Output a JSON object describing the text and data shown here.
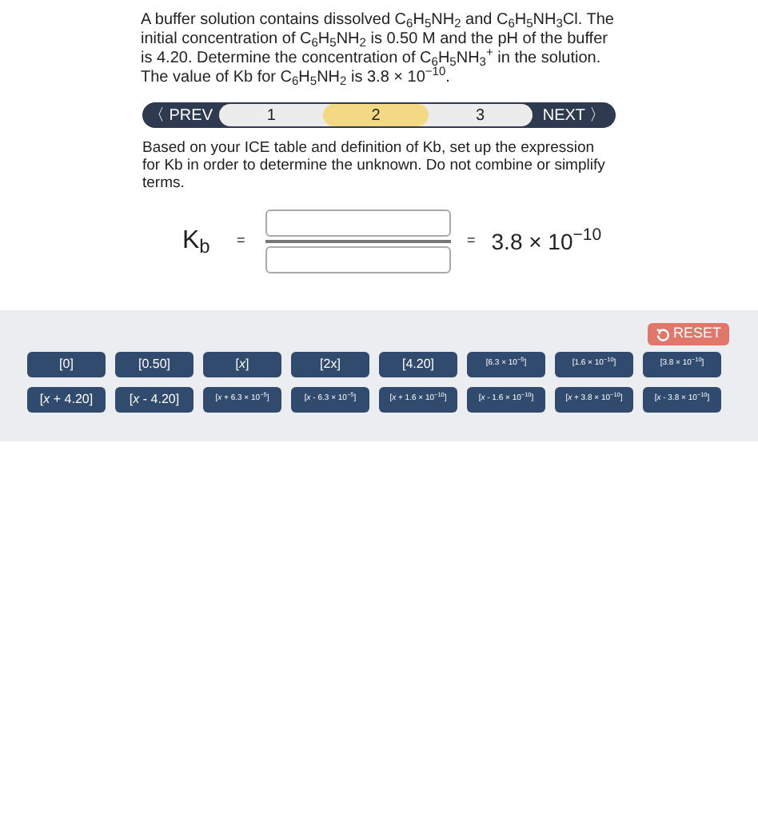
{
  "question": "A buffer solution contains dissolved C$_{6}$H$_{5}$NH$_{2}$ and C$_{6}$H$_{5}$NH$_{3}$Cl. The initial concentration of C$_{6}$H$_{5}$NH$_{2}$ is 0.50 M and the pH of the buffer is 4.20. Determine the concentration of C$_{6}$H$_{5}$NH$_{3}$$^{+}$ in the solution. The value of Kb for C$_{6}$H$_{5}$NH$_{2}$ is 3.8 × 10$^{−10}$.",
  "nav": {
    "prev": "〈 PREV",
    "next": "NEXT 〉",
    "steps": [
      {
        "label": "1",
        "selected": false
      },
      {
        "label": "2",
        "selected": true
      },
      {
        "label": "3",
        "selected": false
      }
    ]
  },
  "instruction": "Based on your ICE table and definition of Kb, set up the expression for Kb in order to determine the unknown. Do not combine or simplify terms.",
  "equation": {
    "lhs": "K$_{b}$",
    "equals": "=",
    "rhs_equals": "=",
    "rhs": "3.8 × 10$^{−10}$"
  },
  "reset": "RESET",
  "tiles": [
    [
      "[0]",
      "[0.50]",
      "[*x*]",
      "[2x]",
      "[4.20]",
      "[6.3 × 10$^{−5}$]",
      "[1.6 × 10$^{−10}$]",
      "[3.8 × 10$^{−10}$]"
    ],
    [
      "[*x* + 4.20]",
      "[*x* - 4.20]",
      "[*x* + 6.3 × 10$^{−5}$]",
      "[*x* - 6.3 × 10$^{−5}$]",
      "[*x* + 1.6 × 10$^{−10}$]",
      "[*x* - 1.6 × 10$^{−10}$]",
      "[*x* + 3.8 × 10$^{−10}$]",
      "[*x* - 3.8 × 10$^{−10}$]"
    ]
  ]
}
